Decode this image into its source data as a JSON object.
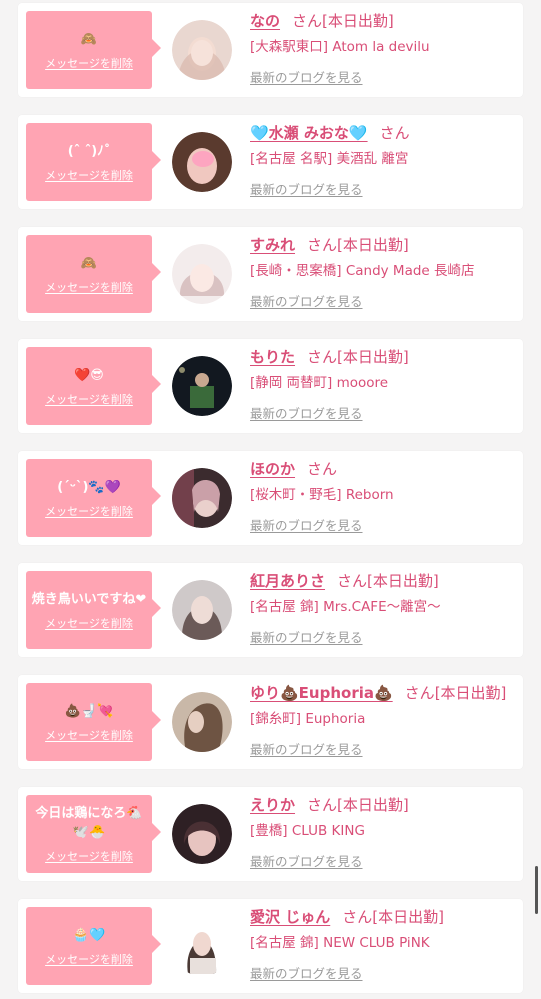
{
  "messages": [
    {
      "bubble_text": "🙈",
      "delete_label": "メッセージを削除",
      "name": "なの",
      "honorific": "さん",
      "status": "[本日出勤]",
      "shop": "[大森駅東口] Atom la devilu",
      "blog_label": "最新のブログを見る",
      "avatar_colors": [
        "#e9d7d0",
        "#c9a79a"
      ]
    },
    {
      "bubble_text": "(ˆ ˆ)ﾉ˚",
      "delete_label": "メッセージを削除",
      "name": "🩵水瀬 みおな🩵",
      "honorific": "さん",
      "status": "",
      "shop": "[名古屋 名駅] 美酒乱 離宮",
      "blog_label": "最新のブログを見る",
      "avatar_colors": [
        "#5a3a2e",
        "#f0c8c0"
      ]
    },
    {
      "bubble_text": "🙈",
      "delete_label": "メッセージを削除",
      "name": "すみれ",
      "honorific": "さん",
      "status": "[本日出勤]",
      "shop": "[長崎・思案橋] Candy Made 長崎店",
      "blog_label": "最新のブログを見る",
      "avatar_colors": [
        "#f3ecec",
        "#d9c2c2"
      ]
    },
    {
      "bubble_text": "❤️😎",
      "delete_label": "メッセージを削除",
      "name": "もりた",
      "honorific": "さん",
      "status": "[本日出勤]",
      "shop": "[静岡 両替町] mooore",
      "blog_label": "最新のブログを見る",
      "avatar_colors": [
        "#121820",
        "#3a6a3a"
      ]
    },
    {
      "bubble_text": "(´ᵕ`)🐾💜",
      "delete_label": "メッセージを削除",
      "name": "ほのか",
      "honorific": "さん",
      "status": "",
      "shop": "[桜木町・野毛] Reborn",
      "blog_label": "最新のブログを見る",
      "avatar_colors": [
        "#3b2b2e",
        "#caa0a8"
      ]
    },
    {
      "bubble_text": "焼き鳥いいですね❤",
      "delete_label": "メッセージを削除",
      "name": "紅月ありさ",
      "honorific": "さん",
      "status": "[本日出勤]",
      "shop": "[名古屋 錦] Mrs.CAFE〜離宮〜",
      "blog_label": "最新のブログを見る",
      "avatar_colors": [
        "#cfc9c9",
        "#6b5a58"
      ]
    },
    {
      "bubble_text": "💩🚽💘",
      "delete_label": "メッセージを削除",
      "name": "ゆり💩Euphoria💩",
      "honorific": "さん",
      "status": "[本日出勤]",
      "shop": "[錦糸町] Euphoria",
      "blog_label": "最新のブログを見る",
      "avatar_colors": [
        "#c9b8a8",
        "#6e5443"
      ]
    },
    {
      "bubble_text": "今日は鶏になろ🐔🕊️🐣",
      "delete_label": "メッセージを削除",
      "name": "えりか",
      "honorific": "さん",
      "status": "[本日出勤]",
      "shop": "[豊橋] CLUB KING",
      "blog_label": "最新のブログを見る",
      "avatar_colors": [
        "#2e2024",
        "#e7c4c0"
      ]
    },
    {
      "bubble_text": "🧁🩵",
      "delete_label": "メッセージを削除",
      "name": "愛沢 じゅん",
      "honorific": "さん",
      "status": "[本日出勤]",
      "shop": "[名古屋 錦] NEW CLUB PiNK",
      "blog_label": "最新のブログを見る",
      "avatar_colors": [
        "#ffffff",
        "#4b3a35"
      ]
    }
  ],
  "colors": {
    "bubble": "#ffa4b3",
    "name": "#d94e77",
    "link_gray": "#9a9a9a",
    "background": "#f5f4f4"
  }
}
